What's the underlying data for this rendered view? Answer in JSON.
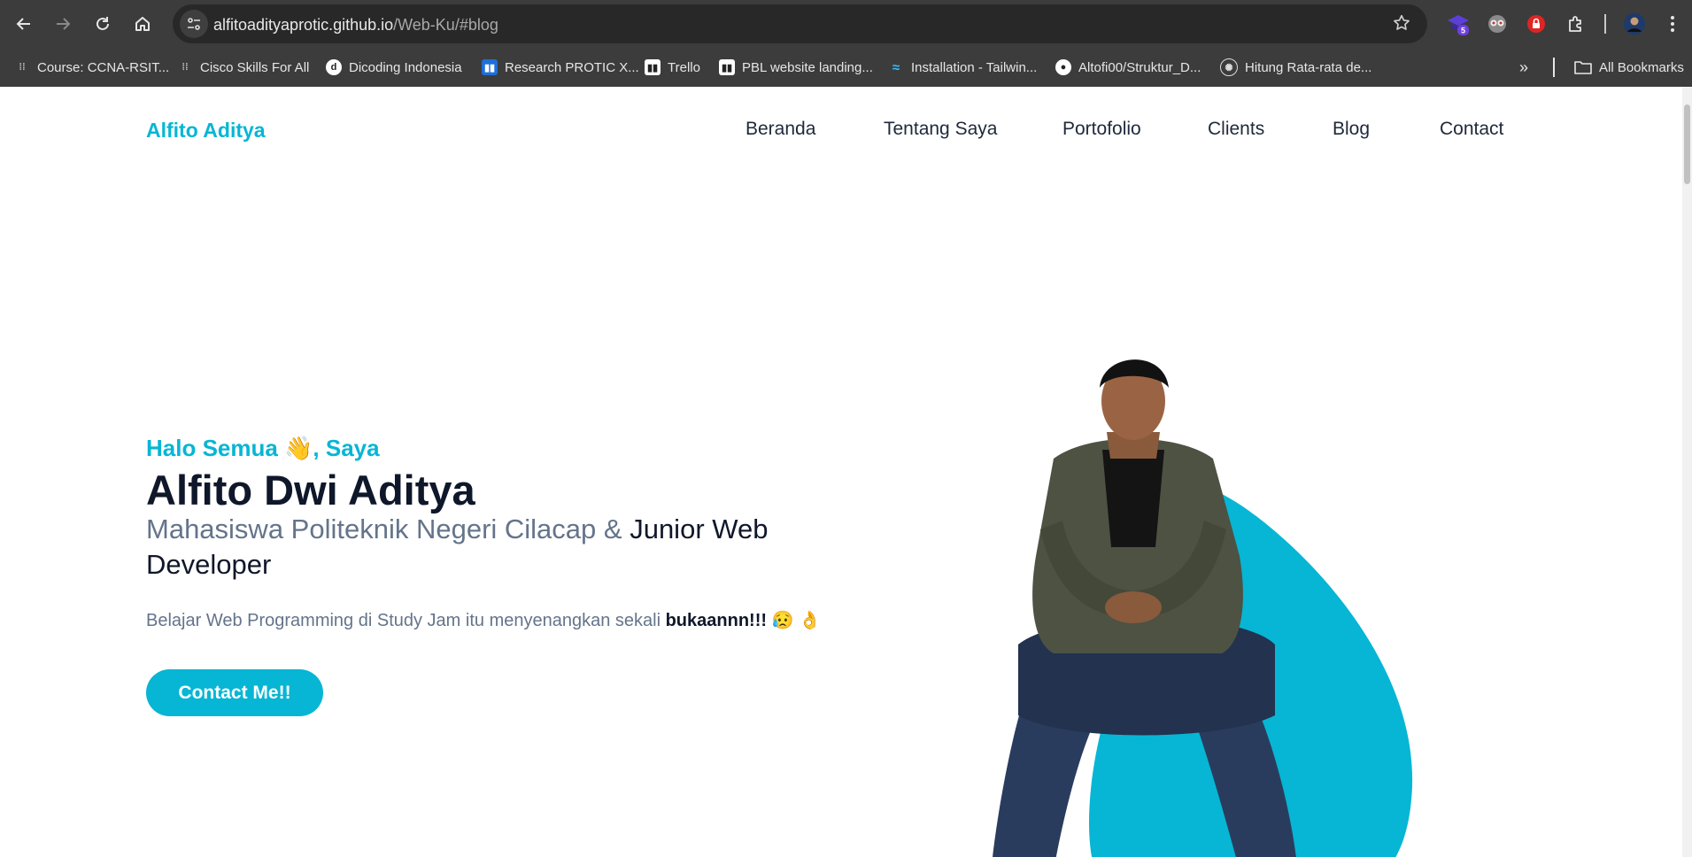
{
  "browser": {
    "url_host": "alfitoadityaprotic.github.io",
    "url_path": "/Web-Ku/#blog",
    "extension_badge": "5",
    "bookmarks": [
      {
        "label": "Course: CCNA-RSIT..."
      },
      {
        "label": "Cisco Skills For All"
      },
      {
        "label": "Dicoding Indonesia"
      },
      {
        "label": "Research PROTIC X..."
      },
      {
        "label": "Trello"
      },
      {
        "label": "PBL website landing..."
      },
      {
        "label": "Installation - Tailwin..."
      },
      {
        "label": "Altofi00/Struktur_D..."
      },
      {
        "label": "Hitung Rata-rata de..."
      }
    ],
    "all_bookmarks": "All Bookmarks"
  },
  "site": {
    "logo": "Alfito Aditya",
    "nav": [
      "Beranda",
      "Tentang Saya",
      "Portofolio",
      "Clients",
      "Blog",
      "Contact"
    ]
  },
  "hero": {
    "greeting": "Halo Semua 👋, Saya",
    "name": "Alfito Dwi Aditya",
    "role_muted": "Mahasiswa Politeknik Negeri Cilacap &",
    "role_strong": "Junior Web Developer",
    "tagline_text": "Belajar Web Programming di Study Jam itu menyenangkan sekali",
    "tagline_bold": "bukaannn!!!",
    "tagline_emoji": "😥 👌",
    "cta": "Contact Me!!"
  },
  "colors": {
    "accent": "#06b6d4",
    "heading": "#0f172a",
    "muted": "#64748b",
    "chrome": "#3c3c3c"
  }
}
